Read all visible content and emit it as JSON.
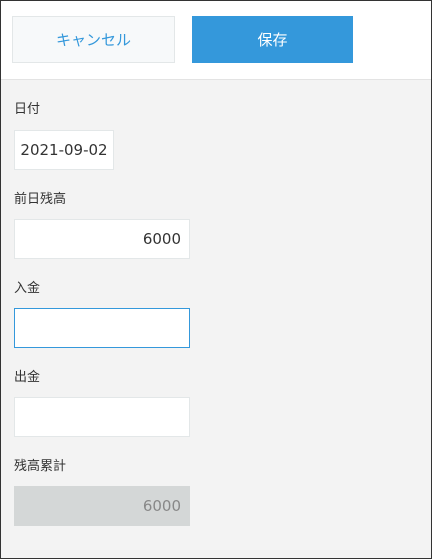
{
  "toolbar": {
    "cancel_label": "キャンセル",
    "save_label": "保存"
  },
  "form": {
    "date": {
      "label": "日付",
      "value": "2021-09-02"
    },
    "prev_balance": {
      "label": "前日残高",
      "value": "6000"
    },
    "deposit": {
      "label": "入金",
      "value": ""
    },
    "withdrawal": {
      "label": "出金",
      "value": ""
    },
    "balance_total": {
      "label": "残高累計",
      "value": "6000"
    }
  },
  "colors": {
    "accent": "#3498db",
    "background": "#f3f3f3",
    "disabled_field": "#d4d7d7"
  }
}
